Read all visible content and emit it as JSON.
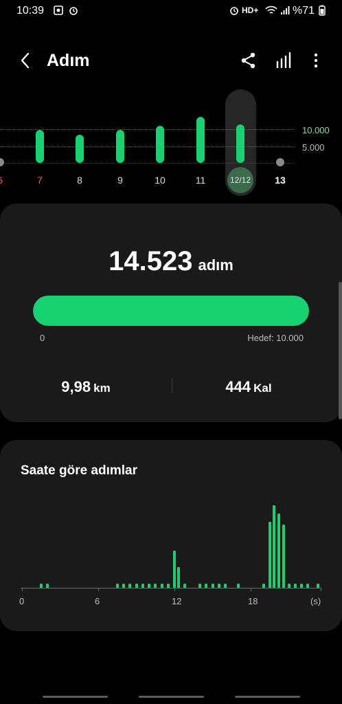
{
  "status_bar": {
    "time": "10:39",
    "network": "HD+",
    "battery": "%71"
  },
  "header": {
    "title": "Adım"
  },
  "week_chart": {
    "days": [
      {
        "label": "6",
        "highlight": "red",
        "value": 0
      },
      {
        "label": "7",
        "highlight": "red",
        "value": 9100
      },
      {
        "label": "8",
        "highlight": "",
        "value": 7800
      },
      {
        "label": "9",
        "highlight": "",
        "value": 9000
      },
      {
        "label": "10",
        "highlight": "",
        "value": 10200
      },
      {
        "label": "11",
        "highlight": "",
        "value": 12600
      },
      {
        "label": "12/12",
        "highlight": "selected",
        "value": 10600
      },
      {
        "label": "13",
        "highlight": "bold",
        "value": 0
      }
    ],
    "ref_lines": [
      "10.000",
      "5.000"
    ]
  },
  "summary": {
    "steps": "14.523",
    "steps_unit": "adım",
    "progress_fraction": 1.0,
    "range_start": "0",
    "goal_label": "Hedef: 10.000",
    "distance_value": "9,98",
    "distance_unit": "km",
    "calories_value": "444",
    "calories_unit": "Kal"
  },
  "hourly": {
    "title": "Saate göre adımlar",
    "x_labels": [
      "0",
      "6",
      "12",
      "18",
      "(s)"
    ]
  },
  "chart_data": {
    "type": "bar",
    "title": "Saate göre adımlar",
    "xlabel": "(s)",
    "x_ticks": [
      0,
      6,
      12,
      18
    ],
    "x_values": [
      1.5,
      2,
      7.5,
      8,
      8.5,
      9,
      9.5,
      10,
      10.5,
      11,
      11.5,
      12,
      12.3,
      12.8,
      14,
      14.5,
      15,
      15.5,
      16,
      17,
      19,
      19.5,
      19.85,
      20.2,
      20.6,
      21,
      21.5,
      22,
      22.5,
      23.3
    ],
    "values": [
      50,
      50,
      50,
      50,
      50,
      50,
      50,
      50,
      50,
      50,
      50,
      450,
      250,
      50,
      50,
      50,
      50,
      50,
      50,
      50,
      50,
      800,
      1000,
      900,
      770,
      50,
      50,
      50,
      50,
      50
    ],
    "colors": {
      "bar": "#16d271",
      "axis": "#6b6b6b"
    }
  },
  "colors": {
    "accent": "#16d271",
    "card": "#1a1a1a",
    "ref_text": "#7ee2a7",
    "red_day": "#ff5a5a"
  }
}
